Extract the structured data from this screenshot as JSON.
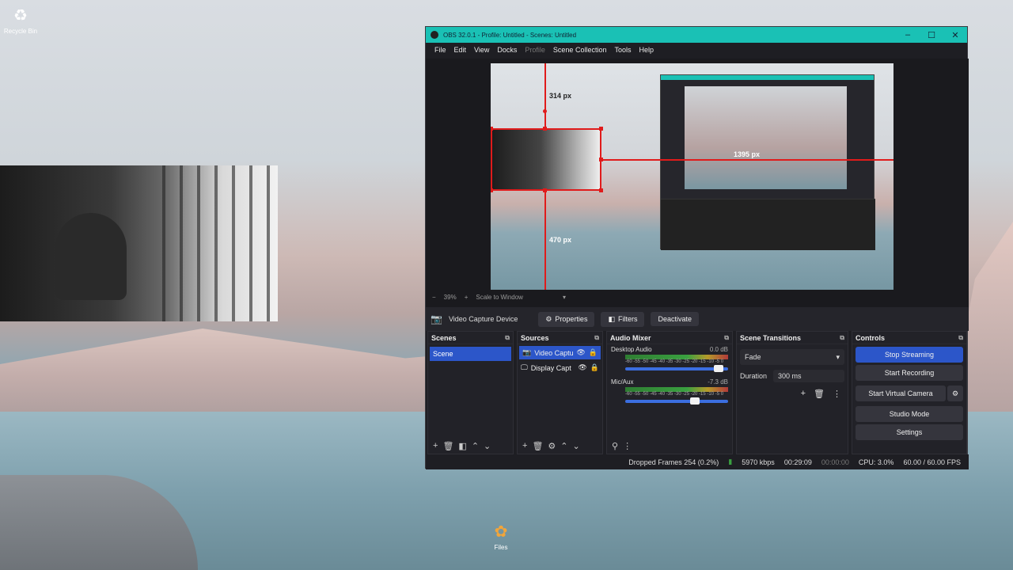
{
  "desktop": {
    "recycle_bin_label": "Recycle Bin",
    "files_label": "Files"
  },
  "window": {
    "title": "OBS 32.0.1 - Profile: Untitled - Scenes: Untitled",
    "controls": [
      "–",
      "☐",
      "✕"
    ]
  },
  "menu": [
    "File",
    "Edit",
    "View",
    "Docks",
    "Profile",
    "Scene Collection",
    "Tools",
    "Help"
  ],
  "preview": {
    "guides": {
      "top": "314 px",
      "right": "1395 px",
      "bottom": "470 px"
    },
    "zoom": "39%",
    "zoom_minus": "−",
    "zoom_plus": "+",
    "scale_mode": "Scale to Window"
  },
  "source_toolbar": {
    "source_name": "Video Capture Device",
    "properties": "Properties",
    "filters": "Filters",
    "deactivate": "Deactivate"
  },
  "scenes": {
    "title": "Scenes",
    "items": [
      "Scene"
    ]
  },
  "sources": {
    "title": "Sources",
    "items": [
      {
        "name": "Video Captu",
        "icon": "camera-icon"
      },
      {
        "name": "Display Capt",
        "icon": "monitor-icon"
      }
    ]
  },
  "mixer": {
    "title": "Audio Mixer",
    "channels": [
      {
        "name": "Desktop Audio",
        "db": "0.0 dB",
        "level": 0.95
      },
      {
        "name": "Mic/Aux",
        "db": "-7.3 dB",
        "level": 0.72
      }
    ],
    "scale": "-60 -55 -50 -45 -40 -35 -30 -25 -20 -15 -10 -5 0"
  },
  "transitions": {
    "title": "Scene Transitions",
    "selected": "Fade",
    "duration_label": "Duration",
    "duration_value": "300 ms"
  },
  "controls": {
    "title": "Controls",
    "stop_streaming": "Stop Streaming",
    "start_recording": "Start Recording",
    "start_virtual_camera": "Start Virtual Camera",
    "studio_mode": "Studio Mode",
    "settings": "Settings"
  },
  "status": {
    "dropped_frames": "Dropped Frames 254 (0.2%)",
    "bitrate": "5970 kbps",
    "stream_time": "00:29:09",
    "record_time": "00:00:00",
    "cpu": "CPU: 3.0%",
    "fps": "60.00 / 60.00 FPS"
  },
  "colors": {
    "accent": "#2c56c9",
    "titlebar": "#1ac1b5",
    "guide": "#e01b1b"
  }
}
